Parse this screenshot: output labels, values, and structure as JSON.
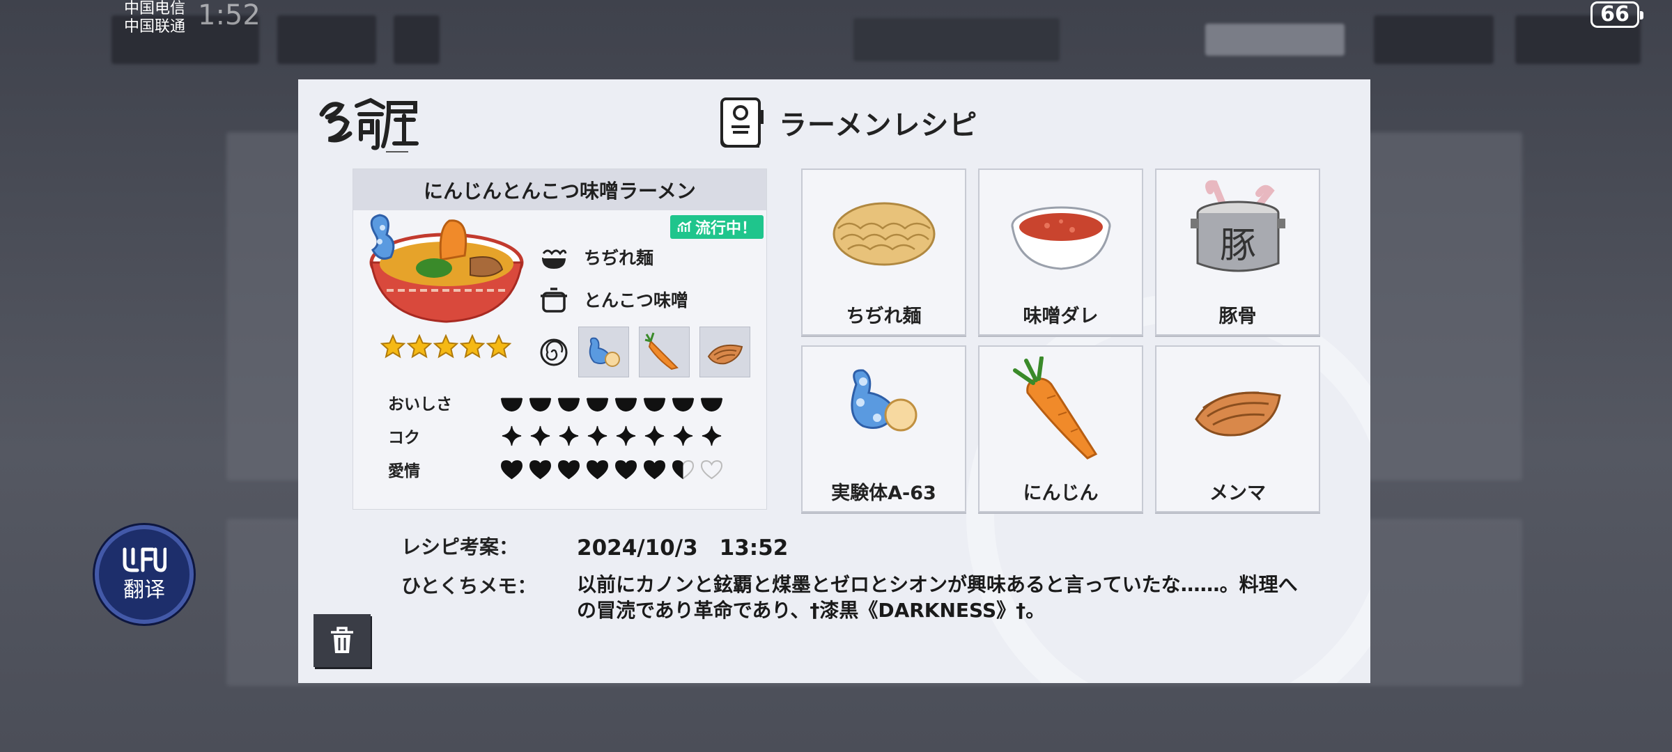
{
  "status_bar": {
    "carrier_1": "中国电信",
    "carrier_2": "中国联通",
    "time": "1:52",
    "battery": "66"
  },
  "background": {
    "tab_label": "騒の巻"
  },
  "translate_widget": {
    "logo": "ᒐᖶᑌ",
    "label": "翻译"
  },
  "modal": {
    "title": "ラーメンレシピ",
    "recipe": {
      "name": "にんじんとんこつ味噌ラーメン",
      "trend_badge": "流行中！",
      "star_rating": 5,
      "noodle": "ちぢれ麺",
      "soup": "とんこつ味噌",
      "toppings_icons": [
        "wasabi-creature-icon",
        "carrot-icon",
        "menma-icon"
      ],
      "stats": [
        {
          "label": "おいしさ",
          "value": 8,
          "max": 8,
          "icon": "bowl-icon"
        },
        {
          "label": "コク",
          "value": 8,
          "max": 8,
          "icon": "sparkle-icon"
        },
        {
          "label": "愛情",
          "value": 6.5,
          "max": 8,
          "icon": "heart-icon"
        }
      ]
    },
    "ingredients": [
      {
        "label": "ちぢれ麺",
        "icon": "noodles-icon"
      },
      {
        "label": "味噌ダレ",
        "icon": "miso-sauce-icon"
      },
      {
        "label": "豚骨",
        "icon": "pork-bone-pot-icon",
        "pot_glyph": "豚"
      },
      {
        "label": "実験体A-63",
        "icon": "wasabi-creature-icon"
      },
      {
        "label": "にんじん",
        "icon": "carrot-icon"
      },
      {
        "label": "メンマ",
        "icon": "menma-icon"
      }
    ],
    "created_label": "レシピ考案：",
    "created_value": "2024/10/3　13:52",
    "memo_label": "ひとくちメモ：",
    "memo_text": "以前にカノンと鉉覇と煤墨とゼロとシオンが興味あると言っていたな……。料理への冒涜であり革命であり、†漆黒《DARKNESS》†。"
  },
  "colors": {
    "modal_bg": "#eceef4",
    "trend_green": "#1fc58c",
    "star_gold": "#f5b915",
    "translate_blue": "#1d2e6b"
  }
}
